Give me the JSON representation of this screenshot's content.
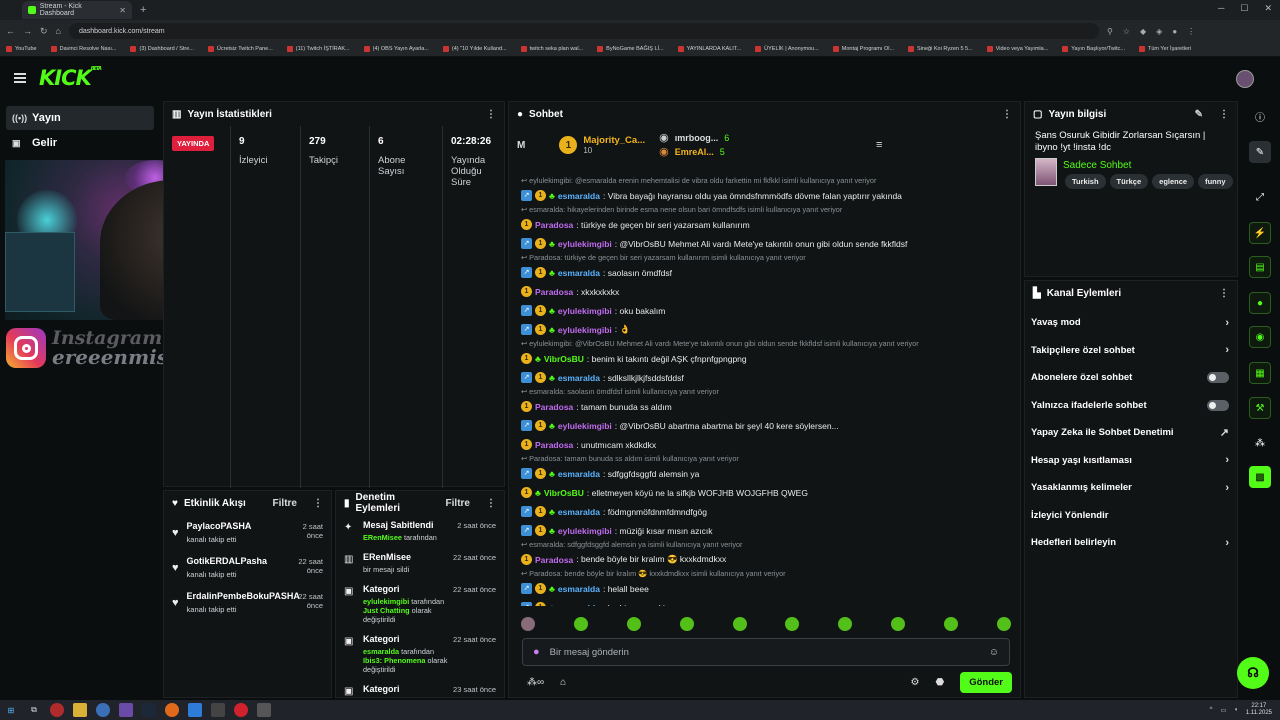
{
  "browser": {
    "tab_title": "Stream - Kick Dashboard",
    "url": "dashboard.kick.com/stream",
    "bookmarks": [
      "YouTube",
      "Davinci Resolve Nası...",
      "(3) Dashboard / Stre...",
      "Ücretsiz Twitch Pane...",
      "(11) Twitch İŞTİRAK...",
      "(4) OBS Yayın Ayarla...",
      "(4) \"10 Yılde Kulland...",
      "twitch seka plan wal...",
      "ByNoGame BAĞIŞ Lİ...",
      "YAYINLARDA KALIT...",
      "ÜYELİK | Anonymou...",
      "Montaj Programı Ol...",
      "Sineği Koi Ryzen 5 5...",
      "Video veya Yayımla...",
      "Yayın Başlıyor/Twitc...",
      "Tüm Yer İşaretleri"
    ]
  },
  "brand": {
    "logo": "KICK",
    "beta": "BETA",
    "accent": "#53fc18"
  },
  "nav": {
    "items": [
      {
        "label": "Yayın",
        "icon": "broadcast-icon"
      },
      {
        "label": "Gelir",
        "icon": "money-icon"
      }
    ]
  },
  "overlay": {
    "insta_line1": "Instagram",
    "insta_line2": "ereeenmise"
  },
  "stats": {
    "title": "Yayın İstatistikleri",
    "live_label": "YAYINDA",
    "cols": [
      {
        "value": "9",
        "label": "İzleyici"
      },
      {
        "value": "279",
        "label": "Takipçi"
      },
      {
        "value": "6",
        "label": "Abone Sayısı"
      },
      {
        "value": "02:28:26",
        "label": "Yayında Olduğu Süre"
      }
    ]
  },
  "activity": {
    "title": "Etkinlik Akışı",
    "filter": "Filtre",
    "items": [
      {
        "name": "PaylacoPASHA",
        "sub": "kanalı takip etti",
        "time": "2 saat önce"
      },
      {
        "name": "GotikERDALPasha",
        "sub": "kanalı takip etti",
        "time": "22 saat önce"
      },
      {
        "name": "ErdalinPembeBokuPASHA",
        "sub": "kanalı takip etti",
        "time": "22 saat önce"
      }
    ]
  },
  "moderation": {
    "title": "Denetim Eylemleri",
    "filter": "Filtre",
    "items": [
      {
        "icon": "pin-icon",
        "name": "Mesaj Sabitlendi",
        "time": "2 saat önce",
        "sub_g": "ERenMisee",
        "sub": "tarafından",
        "sub2": ""
      },
      {
        "icon": "trash-icon",
        "name": "ERenMisee",
        "time": "22 saat önce",
        "sub_g": "",
        "sub": "bir mesajı sildi",
        "sub2": ""
      },
      {
        "icon": "category-icon",
        "name": "Kategori",
        "time": "22 saat önce",
        "sub_g": "eylulekimgibi",
        "sub": "tarafından",
        "sub_g2": "Just Chatting",
        "sub2": "olarak değiştirildi"
      },
      {
        "icon": "category-icon",
        "name": "Kategori",
        "time": "22 saat önce",
        "sub_g": "esmaralda",
        "sub": "tarafından",
        "sub_g2": "Ibis3: Phenomena",
        "sub2": "olarak değiştirildi"
      },
      {
        "icon": "category-icon",
        "name": "Kategori",
        "time": "23 saat önce",
        "sub_g": "",
        "sub": "",
        "sub2": ""
      }
    ]
  },
  "chat": {
    "title": "Sohbet",
    "pinned_letter": "M",
    "leaders": [
      {
        "rank": "1",
        "name": "Majority_Ca...",
        "sub": "10"
      },
      {
        "rank": "",
        "name": "ımrboog...",
        "sub": "6"
      },
      {
        "rank": "",
        "name": "EmreAl...",
        "sub": "5"
      }
    ],
    "messages": [
      {
        "kind": "reply",
        "text": "eylulekimgibi: @esmaralda erenin mehemtalisi de vibra oldu farkettin mi fkfkkl isimli kullanıcıya yanıt veriyor"
      },
      {
        "kind": "msg",
        "user": "esmaralda",
        "color": "#5ab3ff",
        "badges": 3,
        "text": ": Vibra bayağı hayransu oldu yaa ömndsfnmmödfs dövme falan yaptırır yakında"
      },
      {
        "kind": "reply",
        "text": "esmaralda: hikayelerinden birinde esma nene olsun bari ömndfsdfs isimli kullanıcıya yanıt veriyor"
      },
      {
        "kind": "msg",
        "user": "Paradosa",
        "color": "#c06bf0",
        "badges": 1,
        "text": ": türkiye de geçen bir seri yazarsam kullanırım"
      },
      {
        "kind": "msg",
        "user": "eylulekimgibi",
        "color": "#c06bf0",
        "badges": 3,
        "text": ": @VibrOsBU Mehmet Ali vardı Mete'ye takıntılı onun gibi oldun sende fkkfldsf"
      },
      {
        "kind": "reply",
        "text": "Paradosa: türkiye de geçen bir seri yazarsam kullanırım isimli kullanıcıya yanıt veriyor"
      },
      {
        "kind": "msg",
        "user": "esmaralda",
        "color": "#5ab3ff",
        "badges": 3,
        "text": ": saolasın ömdfdsf"
      },
      {
        "kind": "msg",
        "user": "Paradosa",
        "color": "#c06bf0",
        "badges": 1,
        "text": ": xkxkxkxkx"
      },
      {
        "kind": "msg",
        "user": "eylulekimgibi",
        "color": "#c06bf0",
        "badges": 3,
        "text": ": oku bakalım"
      },
      {
        "kind": "msg",
        "user": "eylulekimgibi",
        "color": "#c06bf0",
        "badges": 3,
        "text": ": 👌"
      },
      {
        "kind": "reply",
        "text": "eylulekimgibi: @VibrOsBU Mehmet Ali vardı Mete'ye takıntılı onun gibi oldun sende fkkfldsf isimli kullanıcıya yanıt veriyor"
      },
      {
        "kind": "msg",
        "user": "VibrOsBU",
        "color": "#53fc18",
        "badges": 2,
        "text": ": benim ki takıntı değil AŞK çfnpnfgpngpng"
      },
      {
        "kind": "msg",
        "user": "esmaralda",
        "color": "#5ab3ff",
        "badges": 3,
        "text": ": sdlksllkjlkjfsddsfddsf"
      },
      {
        "kind": "reply",
        "text": "esmaralda: saolasın ömdfdsf isimli kullanıcıya yanıt veriyor"
      },
      {
        "kind": "msg",
        "user": "Paradosa",
        "color": "#c06bf0",
        "badges": 1,
        "text": ": tamam bunuda ss aldım"
      },
      {
        "kind": "msg",
        "user": "eylulekimgibi",
        "color": "#c06bf0",
        "badges": 3,
        "text": ": @VibrOsBU abartma abartma bir şeyl 40 kere söylersen..."
      },
      {
        "kind": "msg",
        "user": "Paradosa",
        "color": "#c06bf0",
        "badges": 1,
        "text": ": unutmıcam xkdkdkx"
      },
      {
        "kind": "reply",
        "text": "Paradosa: tamam bunuda ss aldım isimli kullanıcıya yanıt veriyor"
      },
      {
        "kind": "msg",
        "user": "esmaralda",
        "color": "#5ab3ff",
        "badges": 3,
        "text": ": sdfggfdsggfd alemsin ya"
      },
      {
        "kind": "msg",
        "user": "VibrOsBU",
        "color": "#53fc18",
        "badges": 2,
        "text": ": elletmeyen köyü ne la sifkjb WOFJHB WOJGFHB QWEG"
      },
      {
        "kind": "msg",
        "user": "esmaralda",
        "color": "#5ab3ff",
        "badges": 3,
        "text": ": födmgnmöfdnmfdmndfgög"
      },
      {
        "kind": "msg",
        "user": "eylulekimgibi",
        "color": "#c06bf0",
        "badges": 3,
        "text": ": müziği kısar mısın azıcık"
      },
      {
        "kind": "reply",
        "text": "esmaralda: sdfggfdsggfd alemsin ya isimli kullanıcıya yanıt veriyor"
      },
      {
        "kind": "msg",
        "user": "Paradosa",
        "color": "#c06bf0",
        "badges": 1,
        "text": ": bende böyle bir kralım 😎 kxxkdmdkxx"
      },
      {
        "kind": "reply",
        "text": "Paradosa: bende böyle bir kralım 😎 kxxkdmdkxx isimli kullanıcıya yanıt veriyor"
      },
      {
        "kind": "msg",
        "user": "esmaralda",
        "color": "#5ab3ff",
        "badges": 3,
        "text": ": helall beee"
      },
      {
        "kind": "msg",
        "user": "esmaralda",
        "color": "#5ab3ff",
        "badges": 3,
        "text": ": kadriye nene kim ya"
      }
    ],
    "input_placeholder": "Bir mesaj gönderin",
    "send_label": "Gönder"
  },
  "stream_info": {
    "title": "Yayın bilgisi",
    "stream_title": "Şans Osuruk Gibidir Zorlarsan Sıçarsın | ibyno !yt !insta !dc",
    "category": "Sadece Sohbet",
    "tags": [
      "Turkish",
      "Türkçe",
      "eglence",
      "funny"
    ]
  },
  "channel_actions": {
    "title": "Kanal Eylemleri",
    "items": [
      {
        "label": "Yavaş mod",
        "ctrl": "chevron"
      },
      {
        "label": "Takipçilere özel sohbet",
        "ctrl": "chevron"
      },
      {
        "label": "Abonelere özel sohbet",
        "ctrl": "toggle"
      },
      {
        "label": "Yalnızca ifadelerle sohbet",
        "ctrl": "toggle"
      },
      {
        "label": "Yapay Zeka ile Sohbet Denetimi",
        "ctrl": "external"
      },
      {
        "label": "Hesap yaşı kısıtlaması",
        "ctrl": "chevron"
      },
      {
        "label": "Yasaklanmış kelimeler",
        "ctrl": "chevron"
      },
      {
        "label": "İzleyici Yönlendir",
        "ctrl": "none"
      },
      {
        "label": "Hedefleri belirleyin",
        "ctrl": "chevron"
      }
    ]
  },
  "taskbar": {
    "time": "22:17",
    "date": "1.11.2025"
  }
}
